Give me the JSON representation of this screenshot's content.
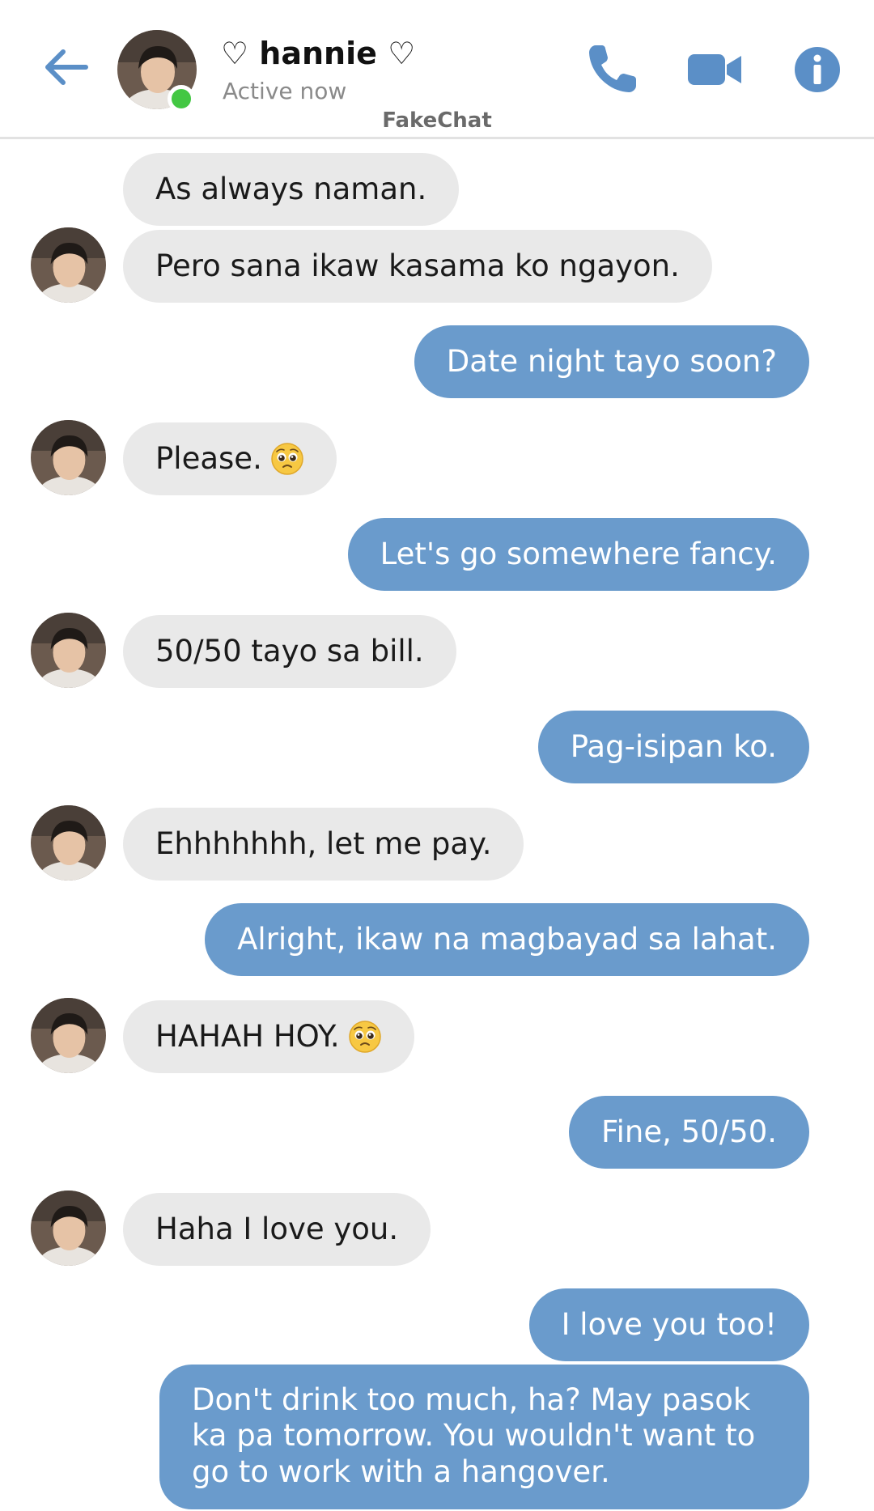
{
  "header": {
    "contact_name": "♡ hannie ♡",
    "contact_status": "Active now",
    "app_name": "FakeChat",
    "icons": [
      "back-arrow-icon",
      "phone-icon",
      "video-camera-icon",
      "info-icon"
    ]
  },
  "colors": {
    "accent": "#5b8fc7",
    "outgoing_bubble": "#6a9bcc",
    "incoming_bubble": "#e9e9e9",
    "online": "#43c743"
  },
  "messages": [
    {
      "side": "in",
      "text": "As always naman."
    },
    {
      "side": "in",
      "text": "Pero sana ikaw kasama ko ngayon."
    },
    {
      "side": "out",
      "text": "Date night tayo soon?"
    },
    {
      "side": "in",
      "text": "Please.",
      "emoji": "pleading-face"
    },
    {
      "side": "out",
      "text": "Let's go somewhere fancy."
    },
    {
      "side": "in",
      "text": "50/50 tayo sa bill."
    },
    {
      "side": "out",
      "text": "Pag-isipan ko."
    },
    {
      "side": "in",
      "text": "Ehhhhhhh, let me pay."
    },
    {
      "side": "out",
      "text": "Alright, ikaw na magbayad sa lahat."
    },
    {
      "side": "in",
      "text": "HAHAH HOY.",
      "emoji": "pleading-face"
    },
    {
      "side": "out",
      "text": "Fine, 50/50."
    },
    {
      "side": "in",
      "text": "Haha I love you."
    },
    {
      "side": "out",
      "text": "I love you too!"
    },
    {
      "side": "out",
      "text": "Don't drink too much, ha? May pasok ka pa tomorrow. You wouldn't want to go to work with a hangover."
    }
  ]
}
